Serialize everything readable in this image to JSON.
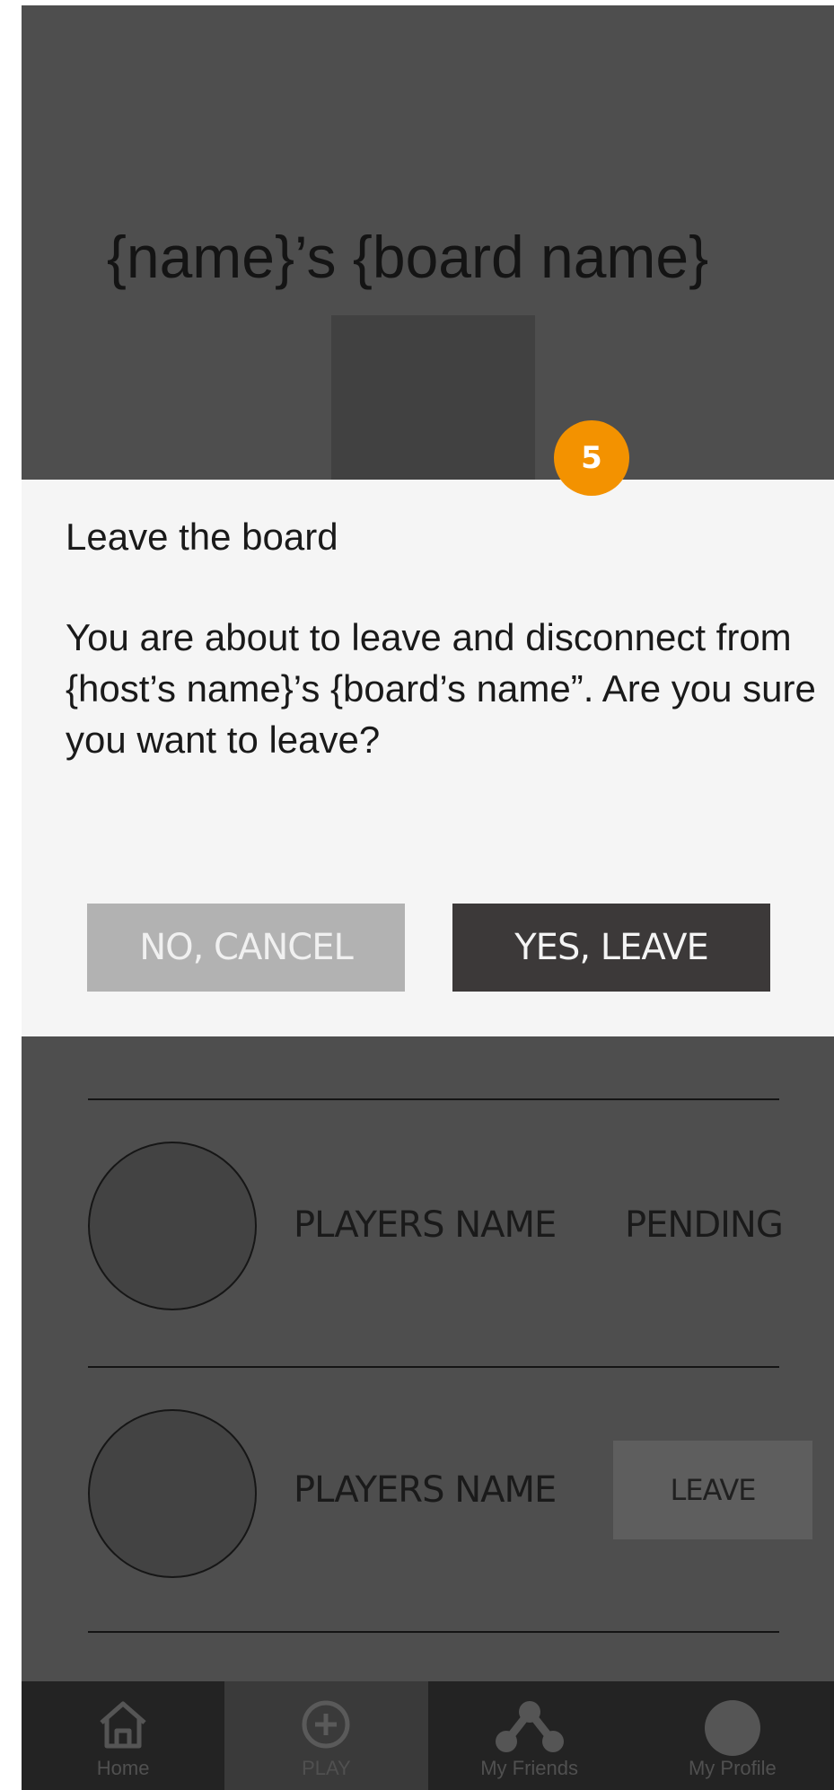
{
  "board": {
    "title": "{name}’s {board name}"
  },
  "modal": {
    "title": "Leave the board",
    "body": "You are about to leave and disconnect from {host’s name}’s {board’s name”. Are you sure you want to leave?",
    "cancel_label": "NO, CANCEL",
    "confirm_label": "YES, LEAVE"
  },
  "step_badge": "5",
  "players": [
    {
      "name": "PLAYERS NAME",
      "status": "PENDING"
    },
    {
      "name": "PLAYERS NAME",
      "action_label": "LEAVE"
    }
  ],
  "nav": {
    "items": [
      {
        "label": "Home",
        "icon": "home-icon"
      },
      {
        "label": "PLAY",
        "icon": "plus-circle-icon",
        "active": true
      },
      {
        "label": "My Friends",
        "icon": "friends-network-icon"
      },
      {
        "label": "My Profile",
        "icon": "profile-avatar-icon"
      }
    ]
  },
  "colors": {
    "overlay_background": "#4e4e4e",
    "modal_background": "#f5f5f5",
    "badge": "#f39200",
    "confirm_button": "#3c3939",
    "cancel_button": "#b2b2b2",
    "nav_background": "#232323"
  }
}
